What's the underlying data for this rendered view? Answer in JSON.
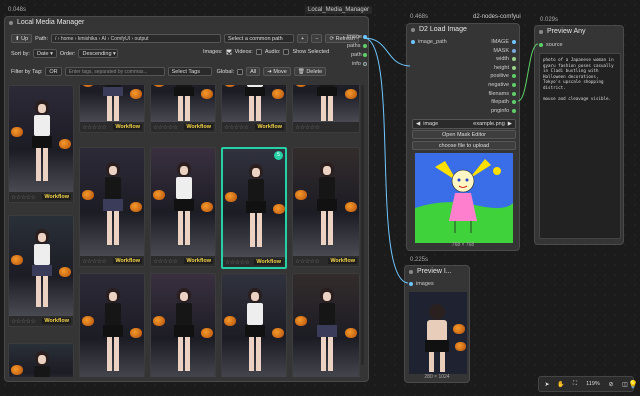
{
  "lmm": {
    "title": "Local Media Manager",
    "badge": "Local_Media_Manager",
    "timing": "0.048s",
    "up_label": "Up",
    "path_label": "Path:",
    "breadcrumb": [
      "/",
      "home",
      "kmishika",
      "AI",
      "ComfyUI",
      "output"
    ],
    "common_path_placeholder": "Select a common path",
    "refresh_label": "Refresh",
    "sort_by_label": "Sort by:",
    "sort_by_value": "Date",
    "order_label": "Order:",
    "order_value": "Descending",
    "images_label": "Images:",
    "videos_label": "Videos:",
    "audio_label": "Audio:",
    "show_selected_label": "Show Selected",
    "filter_label": "Filter by Tag:",
    "filter_mode": "OR",
    "tag_placeholder": "Enter tags, separated by commas...",
    "select_tags_label": "Select Tags",
    "global_label": "Global:",
    "all_label": "All",
    "move_label": "Move",
    "delete_label": "Delete",
    "workflow_label": "Workflow",
    "stars": "☆☆☆☆☆",
    "outputs": [
      "image",
      "paths",
      "path",
      "info"
    ],
    "selected_badge": "5"
  },
  "d2": {
    "title": "D2 Load Image",
    "timing": "0.468s",
    "badge": "d2-nodes-comfyui",
    "input": "image_path",
    "outputs": [
      "IMAGE",
      "MASK",
      "width",
      "height",
      "positive",
      "negative",
      "filenams",
      "filepath",
      "pnginfo"
    ],
    "image_widget_label": "image",
    "image_widget_value": "example.png",
    "open_mask_editor": "Open Mask Editor",
    "choose_file": "choose file to upload",
    "dims": "768 × 768"
  },
  "preview_any": {
    "title": "Preview Any",
    "timing": "0.029s",
    "input": "source",
    "text": "photo of a Japanese woman in gyaru fashion poses casually in Cladi bustling with Halloween decorations, Tokyo's upscale shopping district.\n\nmouse and cleavage visible."
  },
  "preview_image": {
    "title": "Preview I...",
    "timing": "0.225s",
    "input": "images",
    "dims": "280 × 1024"
  },
  "toolbar": {
    "zoom": "119%"
  },
  "colors": {
    "accent_teal": "#26d0a6",
    "link_blue": "#6ec6ff",
    "workflow_yellow": "#f5d54a"
  }
}
